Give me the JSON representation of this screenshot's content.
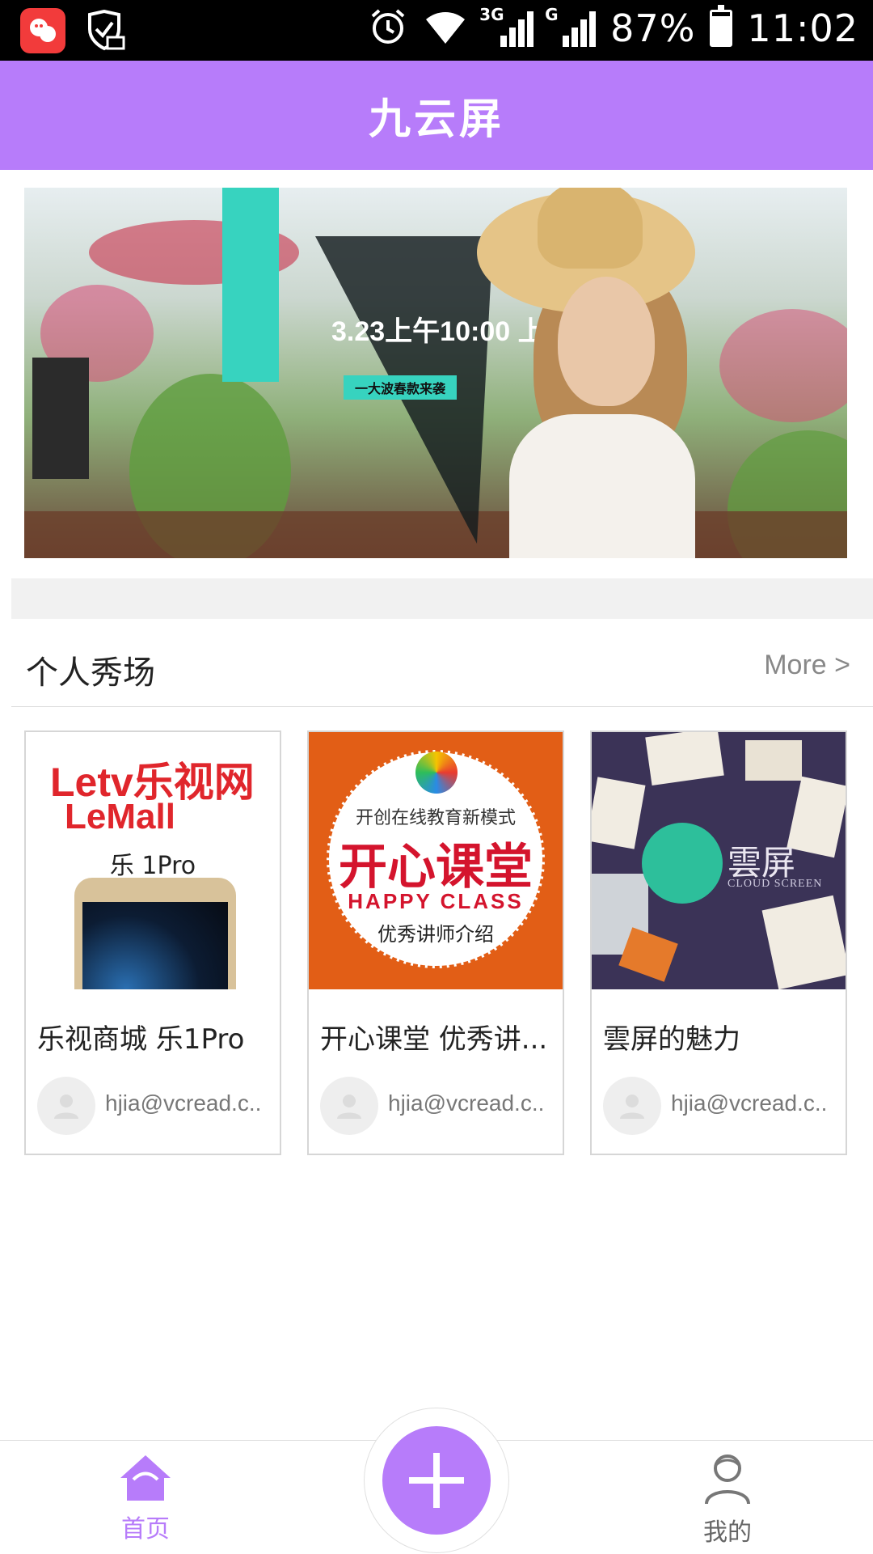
{
  "status_bar": {
    "network_a": "3G",
    "network_b": "G",
    "battery": "87%",
    "battery_level": 0.87,
    "time": "11:02",
    "icons": [
      "app-notification-icon",
      "mail-shield-icon",
      "alarm-icon",
      "wifi-icon",
      "signal-icon",
      "battery-icon"
    ]
  },
  "header": {
    "title": "九云屏"
  },
  "banner": {
    "headline": "3.23上午10:00 上新",
    "tag": "一大波春款来袭"
  },
  "section": {
    "title": "个人秀场",
    "more": "More >"
  },
  "cards": [
    {
      "title": "乐视商城 乐1Pro",
      "author": "hjia@vcread.c..",
      "thumb": {
        "brand1": "Letv乐视网",
        "brand2": "LeMall",
        "model": "乐 1Pro"
      }
    },
    {
      "title": "开心课堂 优秀讲...",
      "author": "hjia@vcread.c..",
      "thumb": {
        "line1": "开创在线教育新模式",
        "line2": "开心课堂",
        "line3": "HAPPY CLASS",
        "line4": "优秀讲师介绍"
      }
    },
    {
      "title": "雲屏的魅力",
      "author": "hjia@vcread.c..",
      "thumb": {
        "brand": "雲屏",
        "sub": "CLOUD SCREEN"
      }
    }
  ],
  "bottom_nav": {
    "home": "首页",
    "mine": "我的",
    "add_icon": "plus-icon"
  },
  "colors": {
    "accent": "#b77cfa",
    "status_bg": "#000000"
  }
}
